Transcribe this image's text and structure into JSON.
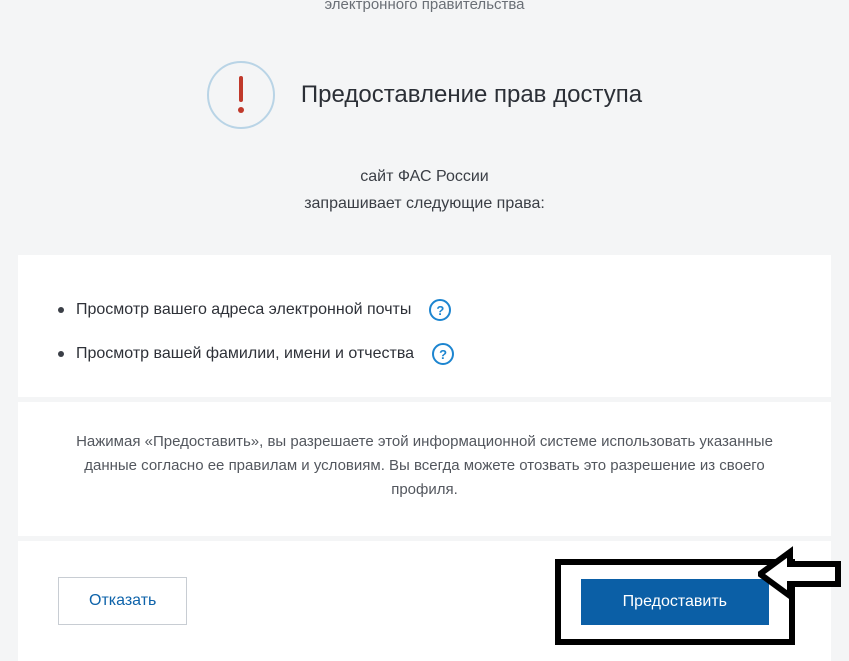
{
  "breadcrumb": "электронного правительства",
  "title": "Предоставление прав доступа",
  "requester_name": "сайт ФАС России",
  "requests_line": "запрашивает следующие права:",
  "permissions": [
    "Просмотр вашего адреса электронной почты",
    "Просмотр вашей фамилии, имени и отчества"
  ],
  "help_glyph": "?",
  "consent_text": "Нажимая «Предоставить», вы разрешаете этой информационной системе использовать указанные данные согласно ее правилам и условиям. Вы всегда можете отозвать это разрешение из своего профиля.",
  "buttons": {
    "decline": "Отказать",
    "grant": "Предоставить"
  },
  "colors": {
    "primary": "#0b5fa6",
    "warn_ring": "#b9d4e6",
    "help_ring": "#1d85d0"
  }
}
